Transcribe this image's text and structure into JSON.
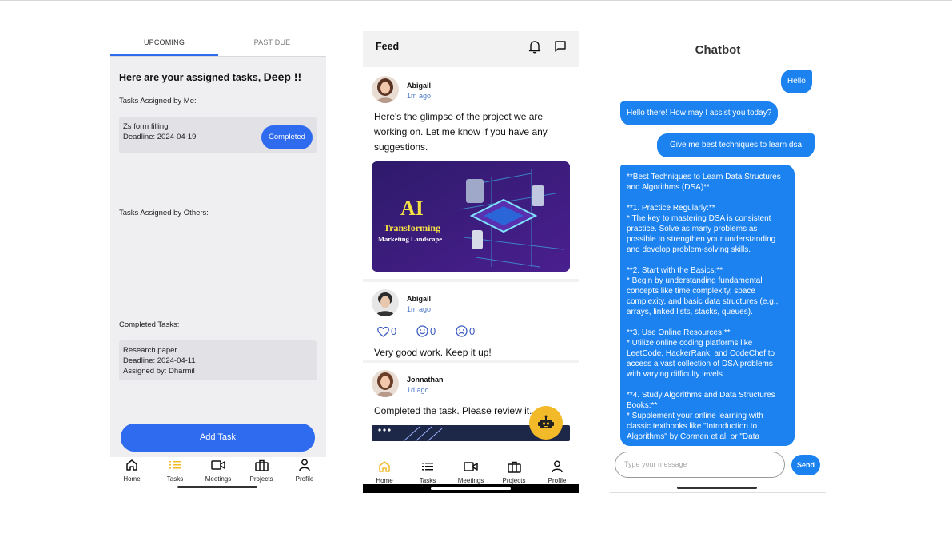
{
  "tasks_screen": {
    "tabs": [
      "UPCOMING",
      "PAST DUE"
    ],
    "greeting": "Here are your assigned tasks,",
    "user_name": "Deep !!",
    "assigned_by_me_label": "Tasks Assigned by Me:",
    "assigned_by_me": [
      {
        "title": "Zs form filling",
        "deadline": "Deadline: 2024-04-19",
        "status_button": "Completed"
      }
    ],
    "assigned_by_others_label": "Tasks Assigned by Others:",
    "completed_label": "Completed Tasks:",
    "completed": [
      {
        "title": "Research paper",
        "deadline": "Deadline: 2024-04-11",
        "assigned_by": "Assigned by: Dharmil"
      }
    ],
    "add_task_button": "Add Task",
    "active_nav": "Tasks"
  },
  "nav_items": [
    "Home",
    "Tasks",
    "Meetings",
    "Projects",
    "Profile"
  ],
  "feed_screen": {
    "title": "Feed",
    "header_icons": [
      "bell-icon",
      "chat-icon"
    ],
    "posts": [
      {
        "author": "Abigail",
        "time": "1m ago",
        "text": "Here's the glimpse of the project we are working on. Let me know if you have any suggestions.",
        "image_title": "AI",
        "image_subtitle": "Transforming",
        "image_caption": "Marketing Landscape"
      },
      {
        "author": "Abigail",
        "time": "1m ago",
        "reactions": [
          {
            "icon": "heart-icon",
            "count": "0"
          },
          {
            "icon": "smile-icon",
            "count": "0"
          },
          {
            "icon": "sad-icon",
            "count": "0"
          }
        ],
        "text": "Very good work. Keep it up!"
      },
      {
        "author": "Jonnathan",
        "time": "1d ago",
        "text": "Completed the task. Please review it."
      }
    ],
    "active_nav": "Home",
    "accent": "#f2b928"
  },
  "chatbot_screen": {
    "title": "Chatbot",
    "messages": [
      {
        "from": "user",
        "text": "Hello"
      },
      {
        "from": "bot",
        "text": "Hello there! How may I assist you today?"
      },
      {
        "from": "user",
        "text": "Give me best techniques to learn dsa"
      },
      {
        "from": "bot",
        "text": "**Best Techniques to Learn Data Structures and Algorithms (DSA)**\n\n**1. Practice Regularly:**\n* The key to mastering DSA is consistent practice. Solve as many problems as possible to strengthen your understanding and develop problem-solving skills.\n\n**2. Start with the Basics:**\n* Begin by understanding fundamental concepts like time complexity, space complexity, and basic data structures (e.g., arrays, linked lists, stacks, queues).\n\n**3. Use Online Resources:**\n* Utilize online coding platforms like LeetCode, HackerRank, and CodeChef to access a vast collection of DSA problems with varying difficulty levels.\n\n**4. Study Algorithms and Data Structures Books:**\n* Supplement your online learning with classic textbooks like \"Introduction to Algorithms\" by Cormen et al. or \"Data"
      }
    ],
    "input_placeholder": "Type your message",
    "send_button": "Send",
    "bubble_color": "#1b82f0"
  },
  "brand_blue": "#2f6bef"
}
